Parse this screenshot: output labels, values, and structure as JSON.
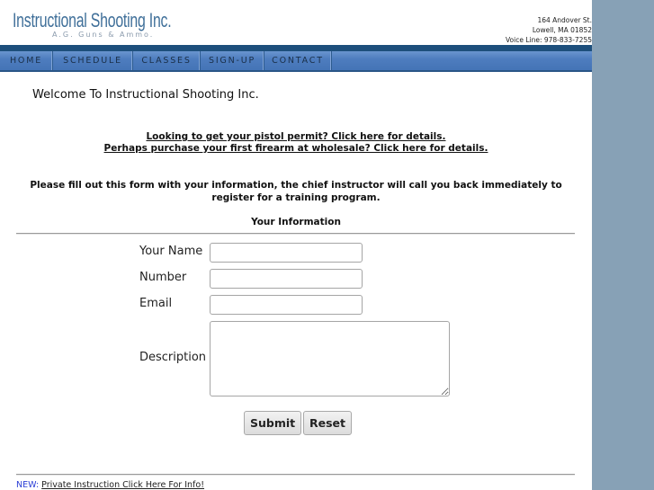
{
  "header": {
    "logo_title": "Instructional Shooting Inc.",
    "logo_subtitle": "A.G. Guns & Ammo.",
    "address_line1": "164 Andover St.",
    "address_line2": "Lowell, MA 01852",
    "phone_line": "Voice Line: 978-833-7255"
  },
  "nav": {
    "items": [
      {
        "label": "HOME"
      },
      {
        "label": "SCHEDULE"
      },
      {
        "label": "CLASSES"
      },
      {
        "label": "SIGN-UP"
      },
      {
        "label": "CONTACT"
      }
    ]
  },
  "main": {
    "welcome": "Welcome To Instructional Shooting Inc.",
    "promo_link_1": "Looking to get your pistol permit? Click here for details.",
    "promo_link_2": "Perhaps purchase your first firearm at wholesale? Click here for details.",
    "intro": "Please fill out this form with your information, the chief instructor will call you back immediately to register for a training program.",
    "section_title": "Your Information"
  },
  "form": {
    "name_label": "Your Name",
    "name_value": "",
    "number_label": "Number",
    "number_value": "",
    "email_label": "Email",
    "email_value": "",
    "description_label": "Description",
    "description_value": "",
    "submit_label": "Submit",
    "reset_label": "Reset"
  },
  "footer": {
    "new_tag": "NEW:",
    "link_text": "Private Instruction Click Here For Info!"
  },
  "colors": {
    "brand": "#3f6f99",
    "nav_dark": "#1d4f7c",
    "nav_bar": "#4e7dbf",
    "side_background": "#87a1b6",
    "new_tag": "#2b3ed6"
  }
}
